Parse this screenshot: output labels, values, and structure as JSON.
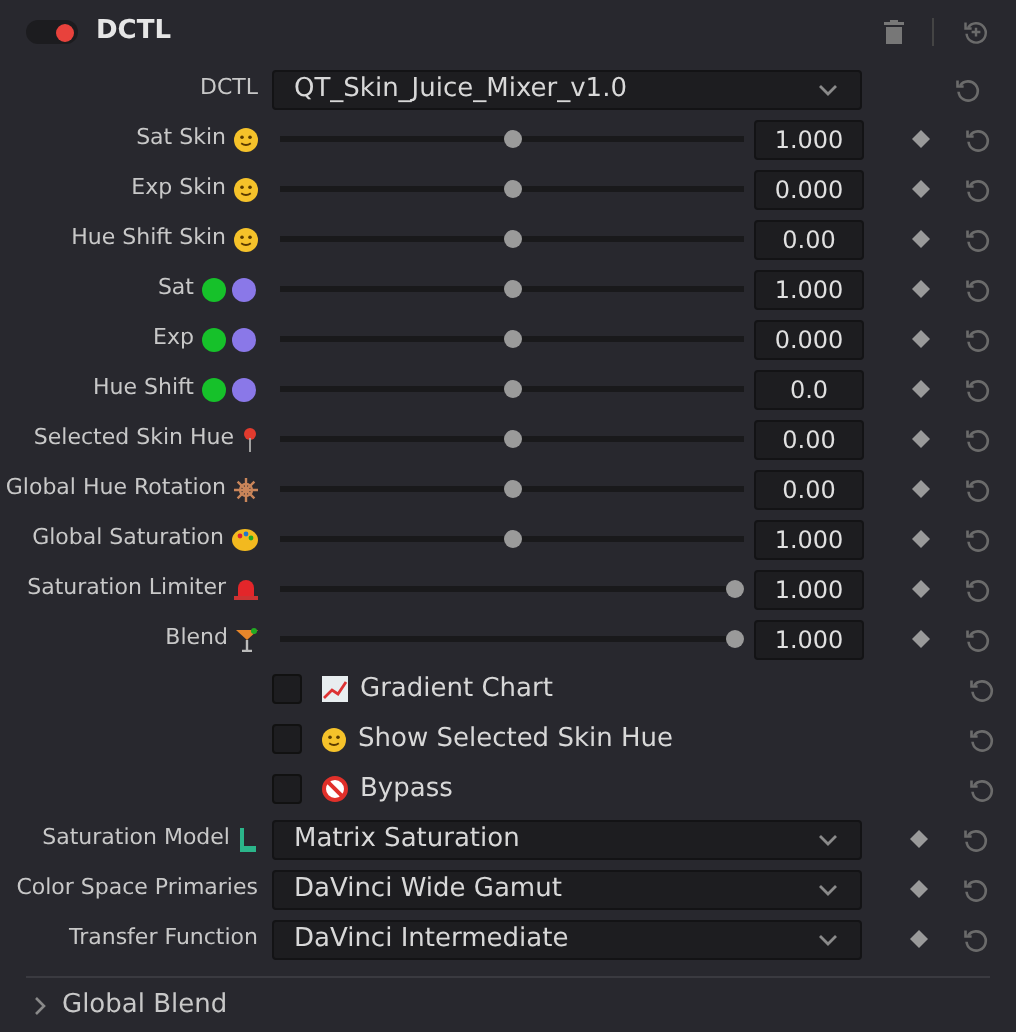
{
  "header": {
    "title": "DCTL",
    "enabled": true
  },
  "dctl": {
    "label": "DCTL",
    "value": "QT_Skin_Juice_Mixer_v1.0"
  },
  "sliders": [
    {
      "label": "Sat Skin",
      "level": 0.5,
      "value": "1.000"
    },
    {
      "label": "Exp Skin",
      "level": 0.5,
      "value": "0.000"
    },
    {
      "label": "Hue Shift Skin",
      "level": 0.5,
      "value": "0.00"
    },
    {
      "label": "Sat",
      "level": 0.5,
      "value": "1.000"
    },
    {
      "label": "Exp",
      "level": 0.5,
      "value": "0.000"
    },
    {
      "label": "Hue Shift",
      "level": 0.5,
      "value": "0.0"
    },
    {
      "label": "Selected Skin Hue",
      "level": 0.5,
      "value": "0.00"
    },
    {
      "label": "Global Hue Rotation",
      "level": 0.5,
      "value": "0.00"
    },
    {
      "label": "Global Saturation",
      "level": 0.5,
      "value": "1.000"
    },
    {
      "label": "Saturation Limiter",
      "level": 1,
      "value": "1.000"
    },
    {
      "label": "Blend",
      "level": 1,
      "value": "1.000"
    }
  ],
  "checkboxes": [
    {
      "label": "Gradient Chart",
      "checked": false
    },
    {
      "label": "Show Selected Skin Hue",
      "checked": false
    },
    {
      "label": "Bypass",
      "checked": false
    }
  ],
  "dropdowns": [
    {
      "label": "Saturation Model",
      "value": "Matrix Saturation"
    },
    {
      "label": "Color Space Primaries",
      "value": "DaVinci Wide Gamut"
    },
    {
      "label": "Transfer Function",
      "value": "DaVinci Intermediate"
    }
  ],
  "footer": {
    "label": "Global Blend",
    "expanded": false
  }
}
